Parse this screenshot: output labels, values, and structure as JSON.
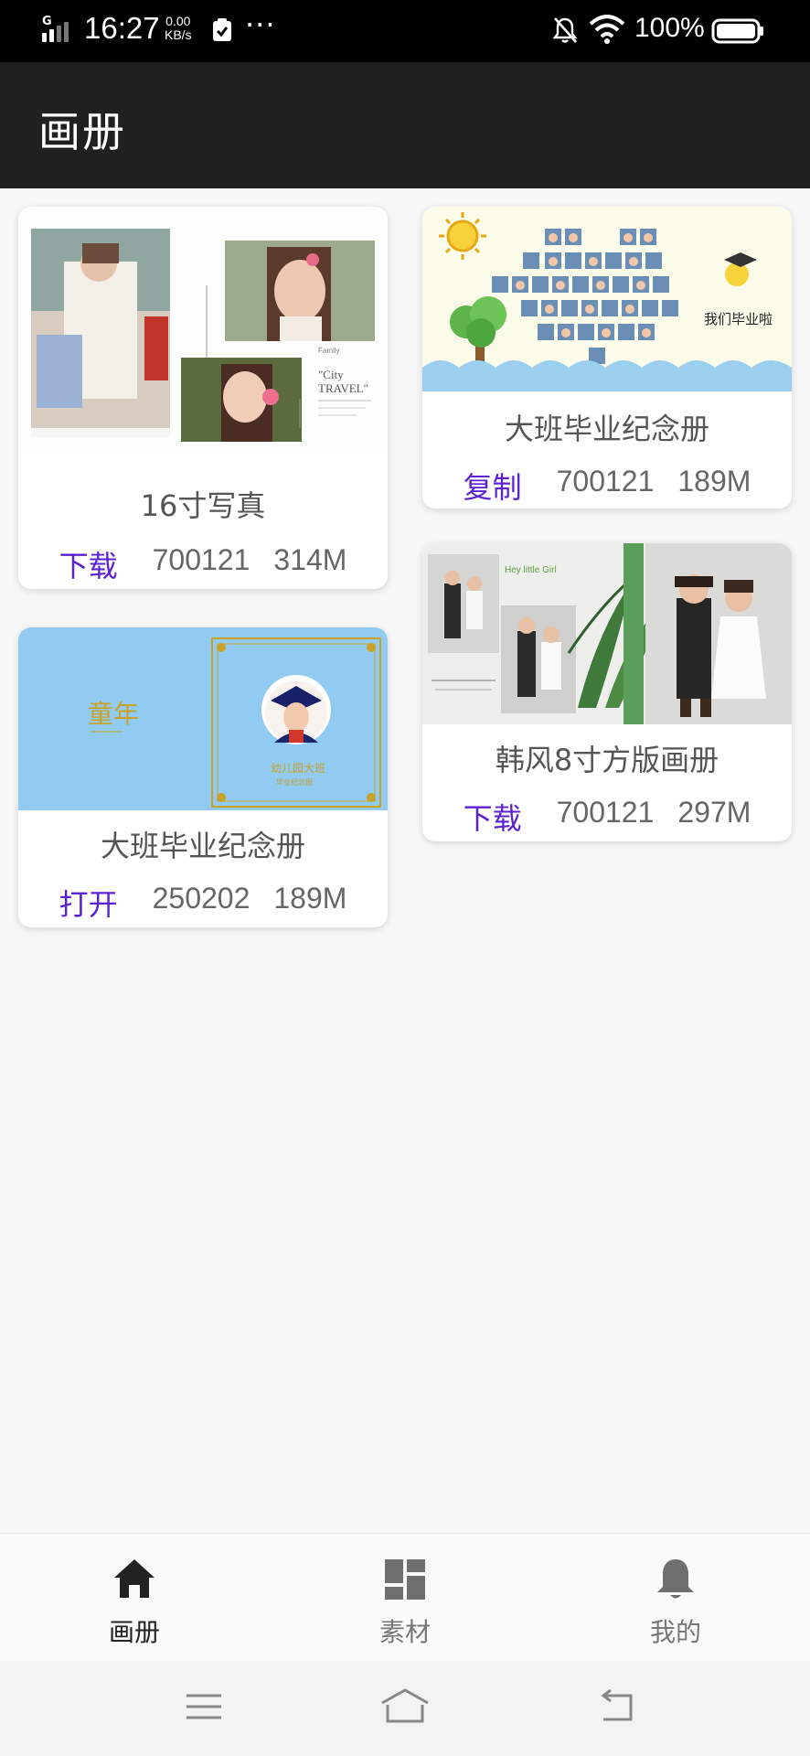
{
  "status_bar": {
    "network_type": "G",
    "time": "16:27",
    "speed_value": "0.00",
    "speed_unit": "KB/s",
    "more": "···",
    "battery_percent": "100%"
  },
  "app_bar": {
    "title": "画册"
  },
  "albums": [
    {
      "title": "16寸写真",
      "action": "下载",
      "code": "700121",
      "size": "314M"
    },
    {
      "title": "大班毕业纪念册",
      "action": "复制",
      "code": "700121",
      "size": "189M"
    },
    {
      "title": "大班毕业纪念册",
      "action": "打开",
      "code": "250202",
      "size": "189M"
    },
    {
      "title": "韩风8寸方版画册",
      "action": "下载",
      "code": "700121",
      "size": "297M"
    }
  ],
  "covers": {
    "travel_text_1": "Family",
    "travel_text_2": "\"City",
    "travel_text_3": "TRAVEL\"",
    "grad_text": "我们毕业啦",
    "blue_left_text": "童年",
    "blue_badge_text": "幼儿园大班",
    "blue_sub_text": "毕业纪念册",
    "korean_text": "Hey little Girl"
  },
  "bottom_nav": {
    "items": [
      {
        "label": "画册",
        "icon": "home-icon",
        "active": true
      },
      {
        "label": "素材",
        "icon": "dashboard-icon",
        "active": false
      },
      {
        "label": "我的",
        "icon": "bell-icon",
        "active": false
      }
    ]
  },
  "colors": {
    "action": "#5b22d1",
    "appbar": "#202020",
    "nav_active": "#222222",
    "nav_inactive": "#777777"
  }
}
